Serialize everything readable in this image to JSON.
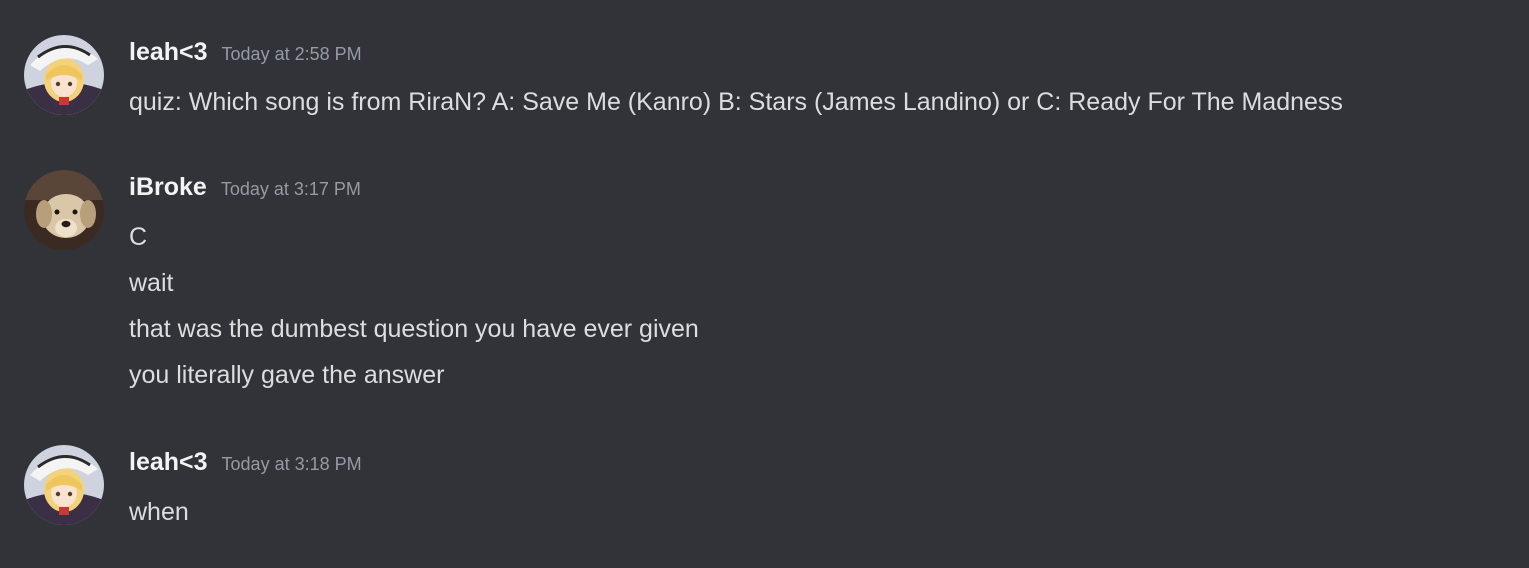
{
  "messages": [
    {
      "username": "leah<3",
      "timestamp": "Today at 2:58 PM",
      "avatar": "anime-girl-witch-hat-avatar",
      "lines": [
        "quiz: Which song is from RiraN? A: Save Me (Kanro) B: Stars (James Landino) or C: Ready For The Madness"
      ]
    },
    {
      "username": "iBroke",
      "timestamp": "Today at 3:17 PM",
      "avatar": "dog-photo-avatar",
      "lines": [
        "C",
        "wait",
        "that was the dumbest question you have ever given",
        "you literally gave the answer"
      ]
    },
    {
      "username": "leah<3",
      "timestamp": "Today at 3:18 PM",
      "avatar": "anime-girl-witch-hat-avatar",
      "lines": [
        "when"
      ]
    }
  ],
  "colors": {
    "background": "#313338",
    "username": "#f2f3f5",
    "timestamp": "#949ba4",
    "message_text": "#dbdee1"
  }
}
